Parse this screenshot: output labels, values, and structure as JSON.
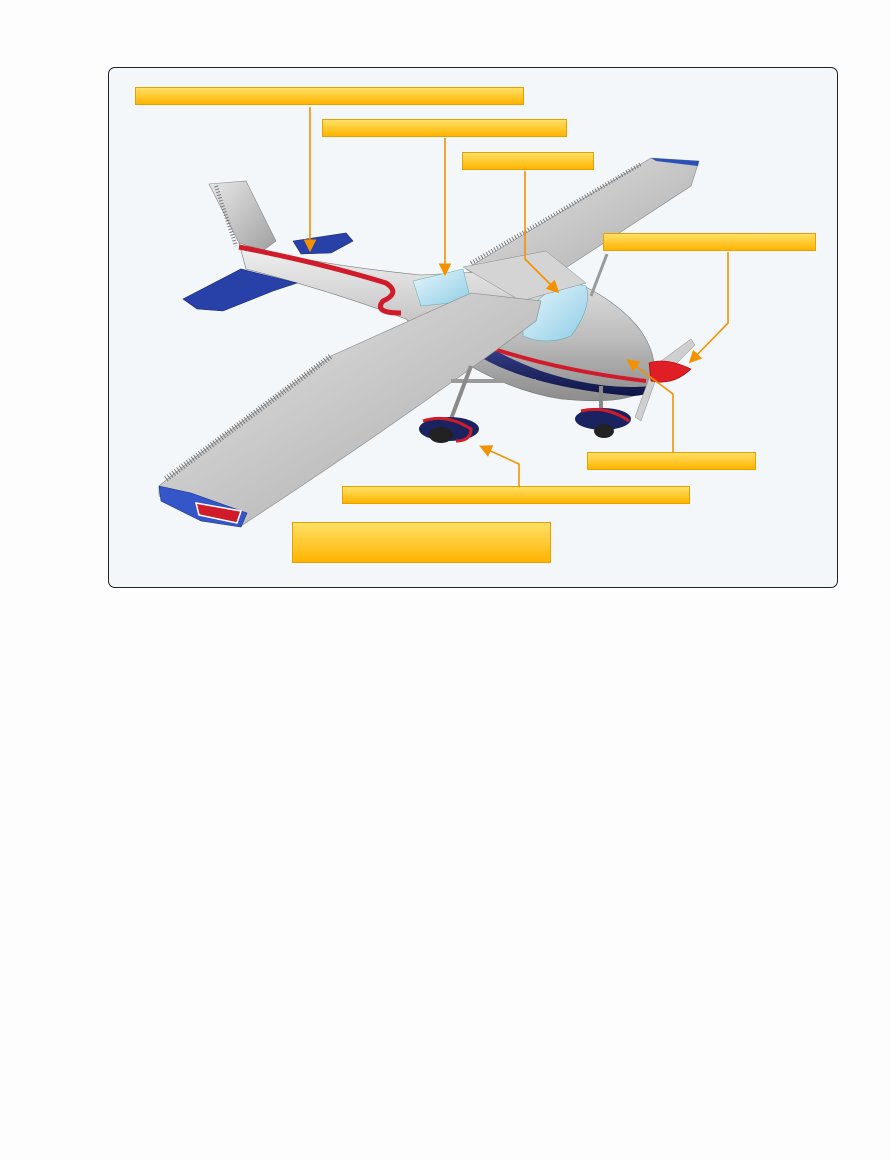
{
  "figure": {
    "colors": {
      "callout_fill_top": "#ffe066",
      "callout_fill_bottom": "#ffb400",
      "leader_line": "#f39200",
      "fuselage": "#c8c8c8",
      "stripe": "#d01c2a",
      "trim_blue": "#1f3f9e",
      "belly": "#1b2260",
      "canopy": "#bde4f2"
    },
    "callouts": [
      {
        "text": ""
      },
      {
        "text": ""
      },
      {
        "text": ""
      },
      {
        "text": ""
      },
      {
        "text": ""
      },
      {
        "text": ""
      },
      {
        "text": ""
      }
    ]
  }
}
